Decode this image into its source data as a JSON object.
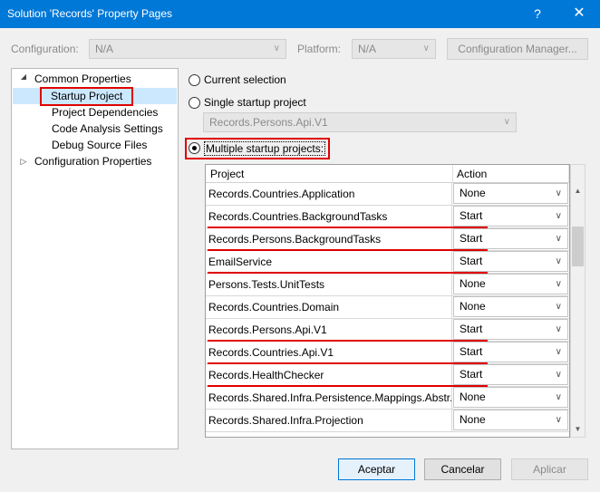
{
  "window": {
    "title": "Solution 'Records' Property Pages",
    "help": "?",
    "close": "✕"
  },
  "config": {
    "configuration_label": "Configuration:",
    "configuration_value": "N/A",
    "platform_label": "Platform:",
    "platform_value": "N/A",
    "manager_button": "Configuration Manager..."
  },
  "tree": {
    "common_properties": "Common Properties",
    "startup_project": "Startup Project",
    "project_dependencies": "Project Dependencies",
    "code_analysis": "Code Analysis Settings",
    "debug_source": "Debug Source Files",
    "configuration_properties": "Configuration Properties"
  },
  "options": {
    "current_selection": "Current selection",
    "single_startup": "Single startup project",
    "single_value": "Records.Persons.Api.V1",
    "multiple_startup": "Multiple startup projects:",
    "selected": "multiple"
  },
  "grid": {
    "header_project": "Project",
    "header_action": "Action",
    "rows": [
      {
        "project": "Records.Countries.Application",
        "action": "None"
      },
      {
        "project": "Records.Countries.BackgroundTasks",
        "action": "Start"
      },
      {
        "project": "Records.Persons.BackgroundTasks",
        "action": "Start"
      },
      {
        "project": "EmailService",
        "action": "Start"
      },
      {
        "project": "Persons.Tests.UnitTests",
        "action": "None"
      },
      {
        "project": "Records.Countries.Domain",
        "action": "None"
      },
      {
        "project": "Records.Persons.Api.V1",
        "action": "Start"
      },
      {
        "project": "Records.Countries.Api.V1",
        "action": "Start"
      },
      {
        "project": "Records.HealthChecker",
        "action": "Start"
      },
      {
        "project": "Records.Shared.Infra.Persistence.Mappings.Abstr...",
        "action": "None"
      },
      {
        "project": "Records.Shared.Infra.Projection",
        "action": "None"
      }
    ]
  },
  "buttons": {
    "ok": "Aceptar",
    "cancel": "Cancelar",
    "apply": "Aplicar"
  },
  "colors": {
    "titlebar": "#0078d7",
    "highlight": "#e00000",
    "selection": "#cce8ff"
  }
}
